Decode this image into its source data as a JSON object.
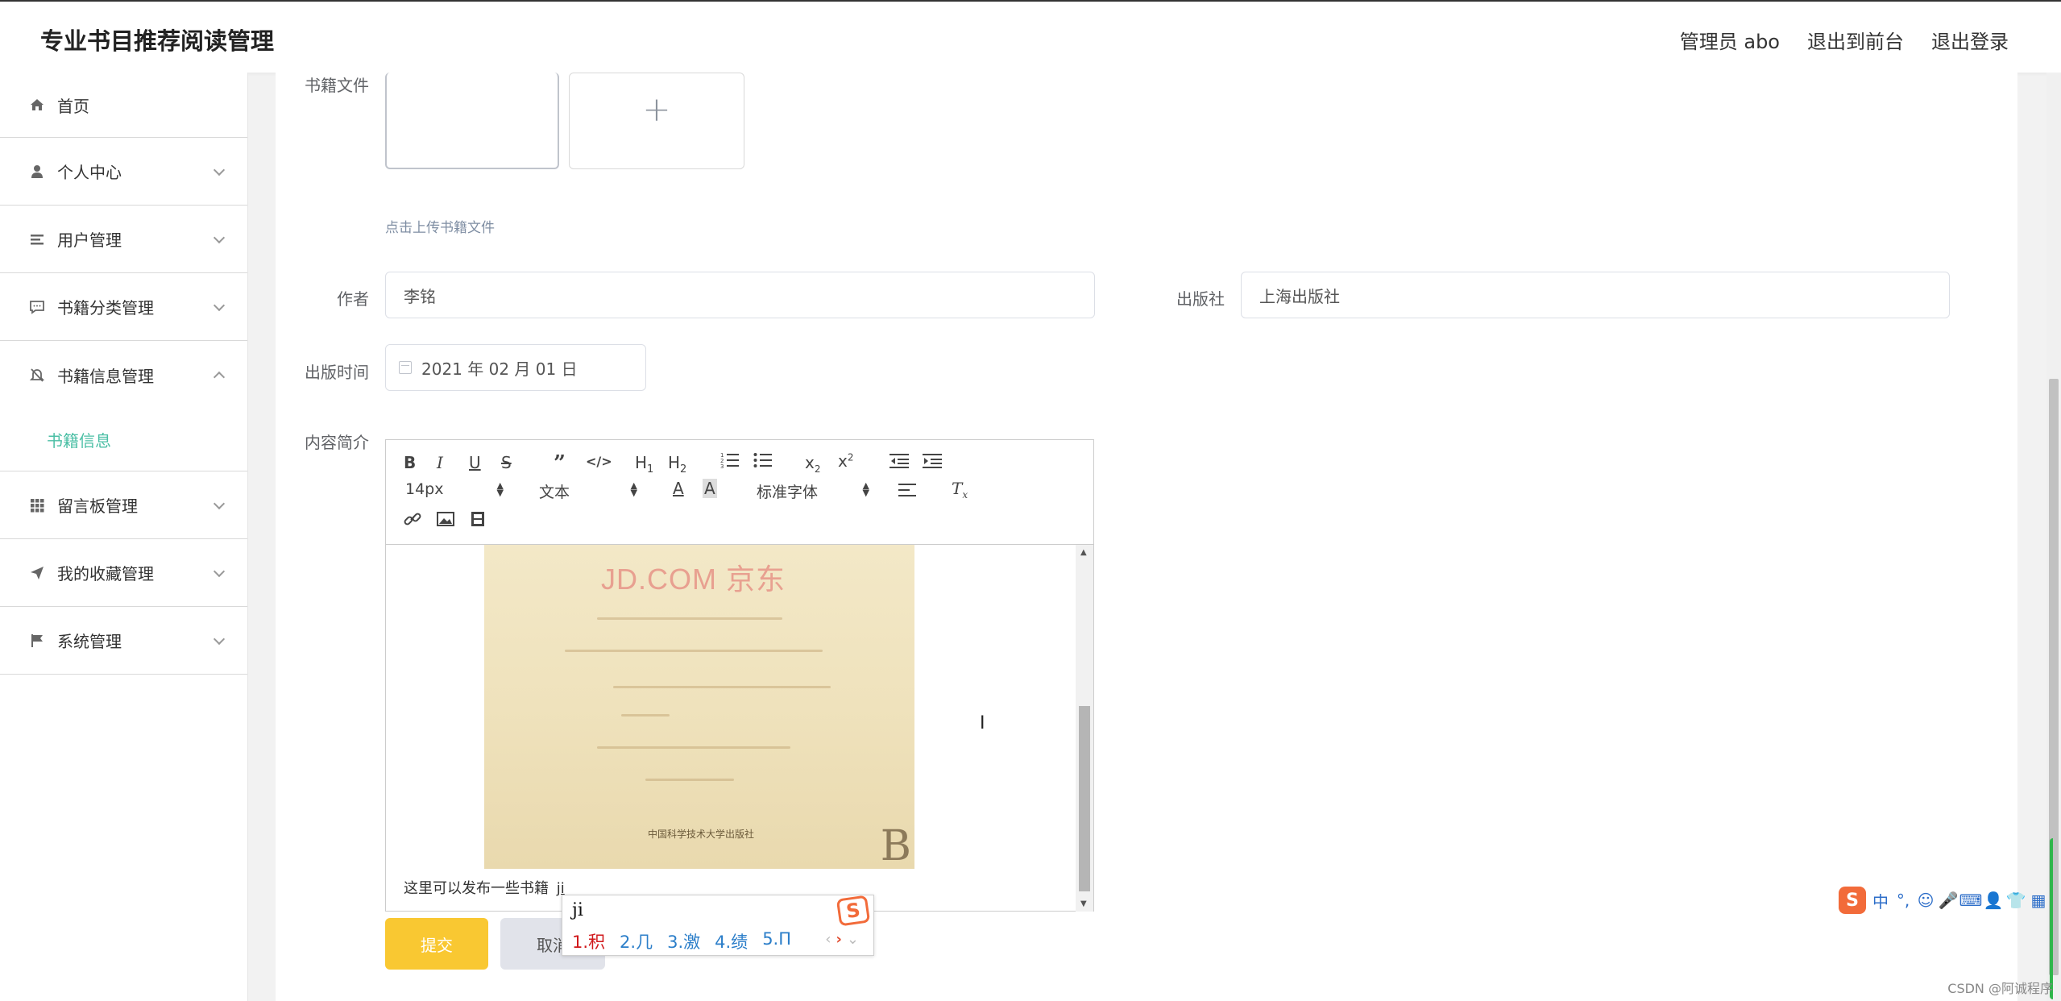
{
  "header": {
    "app_title": "专业书目推荐阅读管理",
    "admin_label": "管理员 abo",
    "exit_frontend": "退出到前台",
    "logout": "退出登录"
  },
  "sidebar": {
    "items": [
      {
        "label": "首页",
        "icon": "home-icon"
      },
      {
        "label": "个人中心",
        "icon": "user-icon"
      },
      {
        "label": "用户管理",
        "icon": "list-icon"
      },
      {
        "label": "书籍分类管理",
        "icon": "chat-icon"
      },
      {
        "label": "书籍信息管理",
        "icon": "bell-off-icon",
        "expanded": true
      },
      {
        "label": "留言板管理",
        "icon": "grid-icon"
      },
      {
        "label": "我的收藏管理",
        "icon": "send-icon"
      },
      {
        "label": "系统管理",
        "icon": "flag-icon"
      }
    ],
    "active_sub": "书籍信息"
  },
  "form": {
    "book_file_label": "书籍文件",
    "upload_hint": "点击上传书籍文件",
    "author_label": "作者",
    "author_value": "李铭",
    "publisher_label": "出版社",
    "publisher_value": "上海出版社",
    "pubdate_label": "出版时间",
    "pubdate_value": "2021 年 02 月 01 日",
    "intro_label": "内容简介",
    "submit": "提交",
    "cancel": "取消"
  },
  "editor": {
    "font_size": "14px",
    "paragraph": "文本",
    "font_family": "标准字体",
    "image_watermark": "JD.COM 京东",
    "image_publisher": "中国科学技术大学出版社",
    "image_letter": "B",
    "body_text": "这里可以发布一些书籍",
    "typing": "ji"
  },
  "ime": {
    "input": "ji",
    "candidates": [
      "1.积",
      "2.几",
      "3.激",
      "4.绩",
      "5.Π"
    ],
    "status_lang": "中"
  },
  "watermark": "CSDN @阿诚程序",
  "colors": {
    "accent": "#4bbfa5",
    "submit": "#f9c832",
    "ime_orange": "#f26b3a"
  }
}
